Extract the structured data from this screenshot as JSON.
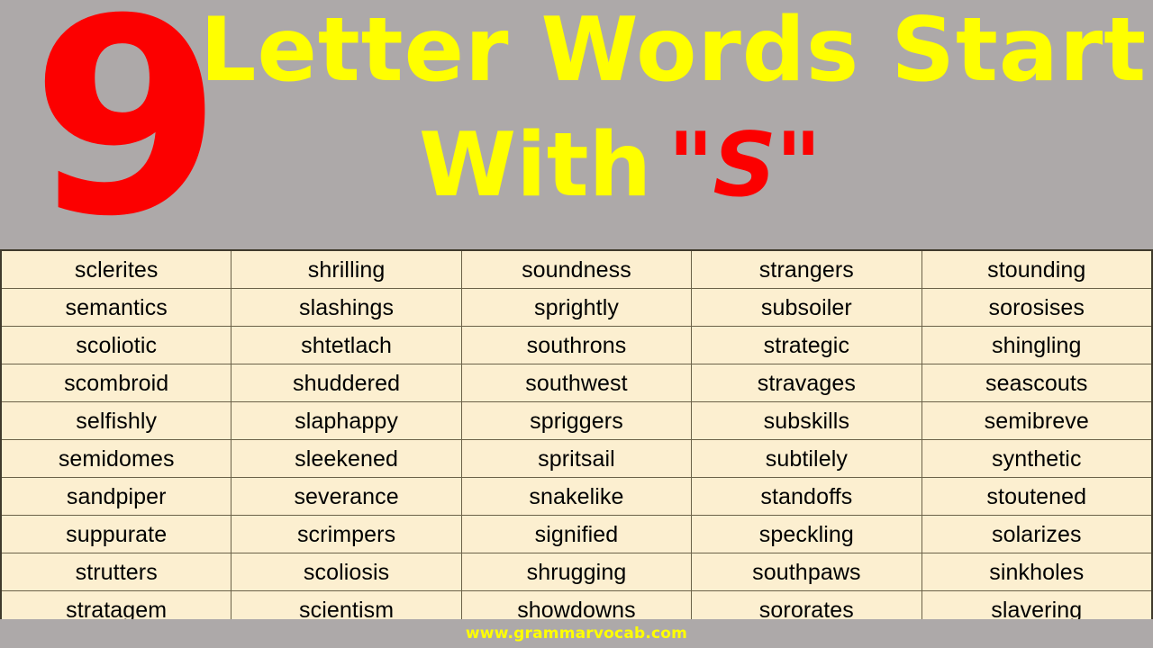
{
  "page": {
    "background_color": "#ada9a9"
  },
  "header": {
    "big_number": "9",
    "big_number_color": "#fc0000",
    "title_color": "#ffff00",
    "title_line_1": "Letter Words Start",
    "title_line_2_prefix": "With",
    "title_line_2_quoted": "\"S\"",
    "title_line_2_quoted_color": "#fc0000"
  },
  "table": {
    "background_color": "#fcefd0",
    "grid_color": "#6b6249",
    "text_color": "#000000",
    "columns": 5,
    "rows": [
      [
        "sclerites",
        "shrilling",
        "soundness",
        "strangers",
        "stounding"
      ],
      [
        "semantics",
        "slashings",
        "sprightly",
        "subsoiler",
        "sorosises"
      ],
      [
        "scoliotic",
        "shtetlach",
        "southrons",
        "strategic",
        "shingling"
      ],
      [
        "scombroid",
        "shuddered",
        "southwest",
        "stravages",
        "seascouts"
      ],
      [
        "selfishly",
        "slaphappy",
        "spriggers",
        "subskills",
        "semibreve"
      ],
      [
        "semidomes",
        "sleekened",
        "spritsail",
        "subtilely",
        "synthetic"
      ],
      [
        "sandpiper",
        "severance",
        "snakelike",
        "standoffs",
        "stoutened"
      ],
      [
        "suppurate",
        "scrimpers",
        "signified",
        "speckling",
        "solarizes"
      ],
      [
        "strutters",
        "scoliosis",
        "shrugging",
        "southpaws",
        "sinkholes"
      ],
      [
        "stratagem",
        "scientism",
        "showdowns",
        "sororates",
        "slavering"
      ]
    ]
  },
  "footer": {
    "url": "www.grammarvocab.com",
    "url_color": "#ffff00"
  }
}
